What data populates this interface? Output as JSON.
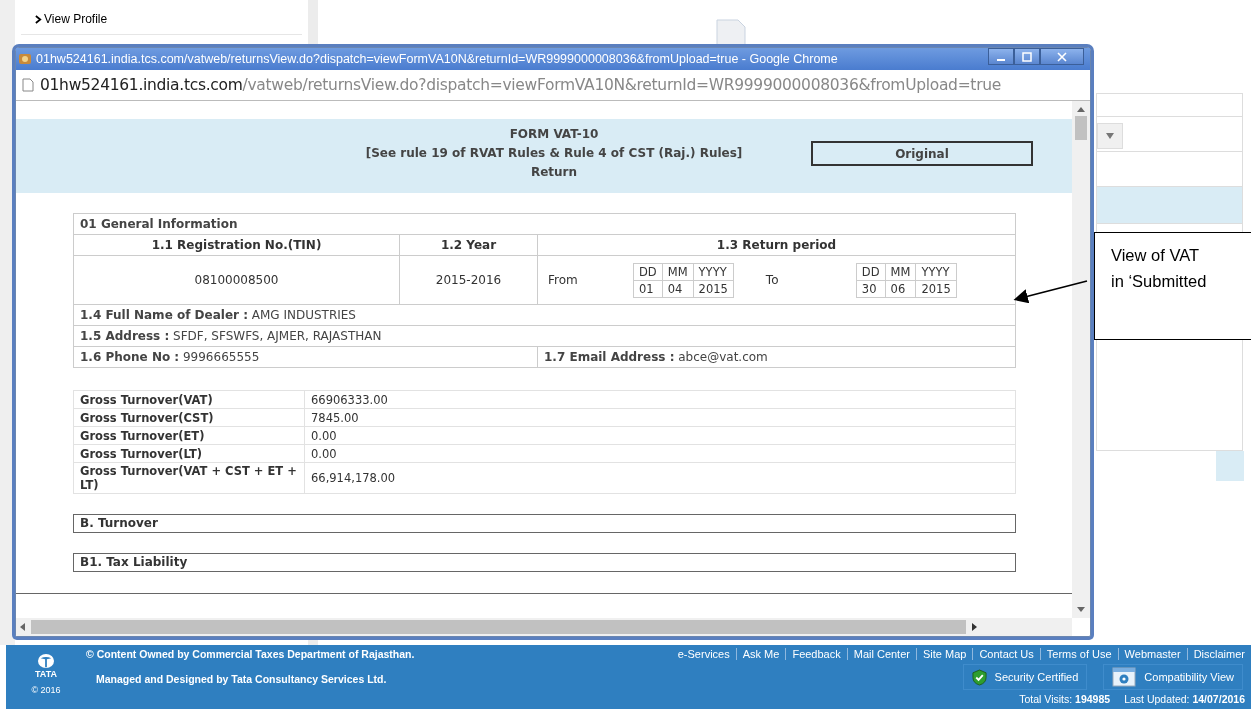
{
  "background_page": {
    "sidebar_items": [
      {
        "label": "View Profile"
      }
    ]
  },
  "popup": {
    "title": "01hw524161.india.tcs.com/vatweb/returnsView.do?dispatch=viewFormVA10N&returnId=WR9999000008036&fromUpload=true - Google Chrome",
    "address": {
      "host": "01hw524161.india.tcs.com",
      "path": "/vatweb/returnsView.do?dispatch=viewFormVA10N&returnId=WR9999000008036&fromUpload=true"
    },
    "form_header": {
      "title": "FORM VAT-10",
      "rule": "[See rule 19 of RVAT Rules & Rule 4 of CST (Raj.) Rules]",
      "subtitle": "Return",
      "status": "Original"
    },
    "general": {
      "heading": "01 General Information",
      "columns": [
        "1.1 Registration No.(TIN)",
        "1.2 Year",
        "1.3 Return period"
      ],
      "tin": "08100008500",
      "year": "2015-2016",
      "from": {
        "label": "From",
        "headers": [
          "DD",
          "MM",
          "YYYY"
        ],
        "values": [
          "01",
          "04",
          "2015"
        ]
      },
      "to": {
        "label": "To",
        "headers": [
          "DD",
          "MM",
          "YYYY"
        ],
        "values": [
          "30",
          "06",
          "2015"
        ]
      },
      "dealer": "**1.4 Full Name of Dealer :** AMG INDUSTRIES",
      "address": "**1.5 Address :**  SFDF,  SFSWFS,  AJMER,  RAJASTHAN",
      "phone": "**1.6 Phone No :** 9996665555",
      "email": "**1.7 Email Address :** abce@vat.com"
    },
    "turnover": [
      {
        "label": "Gross Turnover(VAT)",
        "value": "66906333.00"
      },
      {
        "label": "Gross Turnover(CST)",
        "value": "7845.00"
      },
      {
        "label": "Gross Turnover(ET)",
        "value": "0.00"
      },
      {
        "label": "Gross Turnover(LT)",
        "value": "0.00"
      },
      {
        "label": "Gross Turnover(VAT + CST + ET + LT)",
        "value": "66,914,178.00"
      }
    ],
    "sections": [
      "B. Turnover",
      "B1. Tax Liability"
    ]
  },
  "footer": {
    "logo": "TATA",
    "year": "© 2016",
    "copyright": "© Content Owned by Commercial Taxes Department of Rajasthan.",
    "managed": "Managed and Designed by Tata Consultancy Services Ltd.",
    "links": [
      "e-Services",
      "Ask Me",
      "Feedback",
      "Mail Center",
      "Site Map",
      "Contact Us",
      "Terms of Use",
      "Webmaster",
      "Disclaimer"
    ],
    "badges": [
      {
        "kind": "shield",
        "label": "Security Certified"
      },
      {
        "kind": "compat",
        "label": "Compatibility View"
      }
    ],
    "stats": [
      "Total Visits: **194985**",
      "Last Updated: **14/07/2016**"
    ]
  },
  "callout": {
    "lines": [
      "View of VAT",
      "in ‘Submitted"
    ]
  }
}
